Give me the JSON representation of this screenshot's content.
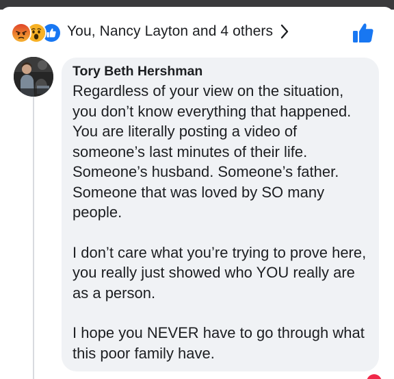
{
  "reactions": {
    "icons": [
      "angry-icon",
      "wow-icon",
      "like-icon"
    ],
    "colors": {
      "angry": "#e9710f",
      "wow": "#f7b125",
      "like": "#1877f2"
    },
    "summary": "You, Nancy Layton and 4 others"
  },
  "comment": {
    "author": "Tory Beth Hershman",
    "paragraphs": [
      "Regardless of your view on the situation, you don’t know everything that happened. You are literally posting a video of someone’s last minutes of their life. Someone’s husband. Someone’s father. Someone that was loved by SO many people.",
      "I don’t care what you’re trying to prove here, you really just showed who YOU really are as a person.",
      "I hope you NEVER have to go through what this poor family have."
    ]
  },
  "colors": {
    "accent": "#1877f2",
    "bubble": "#f0f2f5",
    "text": "#1c1e21"
  }
}
